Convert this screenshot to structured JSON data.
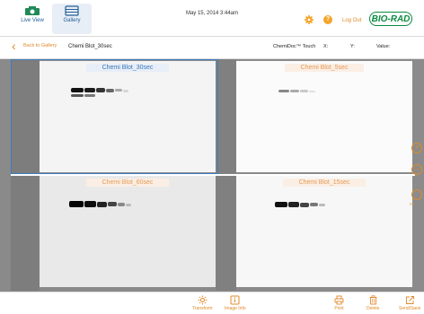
{
  "nav": {
    "live_view": "Live View",
    "gallery": "Gallery"
  },
  "header": {
    "datetime": "May 15, 2014 3:44am",
    "logout": "Log Out",
    "logo": "BIO-RAD",
    "help": "?"
  },
  "subbar": {
    "back_label": "Back to Gallery",
    "image_name": "Chemi Blot_30sec",
    "device": "ChemiDoc™ Touch",
    "x_label": "X:",
    "y_label": "Y:",
    "value_label": "Value:"
  },
  "panels": [
    {
      "title": "Chemi Blot_30sec",
      "selected": true
    },
    {
      "title": "Chemi Blot_5sec",
      "selected": false
    },
    {
      "title": "Chemi Blot_60sec",
      "selected": false
    },
    {
      "title": "Chemi Blot_15sec",
      "selected": false
    }
  ],
  "zoom": {
    "in": "+",
    "out": "−",
    "fit_label": "Fit"
  },
  "toolbar": {
    "transform": "Transform",
    "image_info": "Image Info",
    "print": "Print",
    "delete": "Delete",
    "send_save": "Send/Save"
  },
  "colors": {
    "accent": "#e08a2a",
    "selection": "#3d7cc0",
    "brand": "#0a8a40",
    "nav": "#1f5e96"
  }
}
